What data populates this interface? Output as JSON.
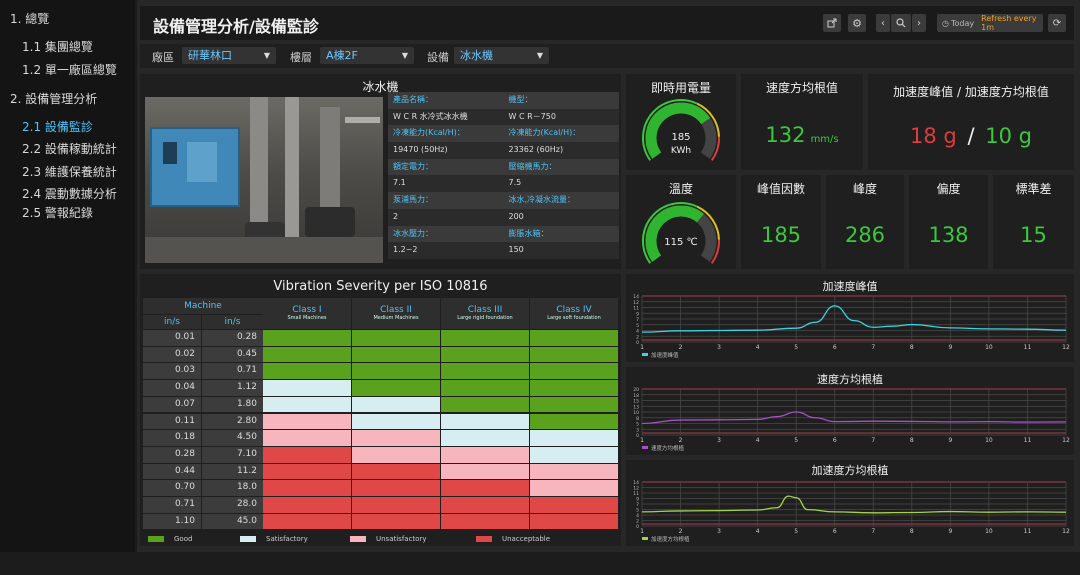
{
  "sidebar": {
    "items": [
      {
        "label": "1. 總覽"
      },
      {
        "label": "1.1 集團總覽"
      },
      {
        "label": "1.2 單一廠區總覽"
      },
      {
        "label": "2. 設備管理分析"
      },
      {
        "label": "2.1 設備監診"
      },
      {
        "label": "2.2 設備稼動統計"
      },
      {
        "label": "2.3 維護保養統計"
      },
      {
        "label": "2.4 震動數據分析"
      },
      {
        "label": "2.5 警報紀錄"
      }
    ]
  },
  "header": {
    "title": "設備管理分析/設備監診",
    "today_label": "Today",
    "refresh_label": "Refresh every 1m"
  },
  "filters": {
    "plant_label": "廠區",
    "plant_value": "研華林口",
    "floor_label": "樓層",
    "floor_value": "A棟2F",
    "device_label": "設備",
    "device_value": "冰水機"
  },
  "equipment": {
    "title": "冰水機",
    "rows": [
      [
        "產品名稱：",
        "機型："
      ],
      [
        "W C R 水冷式冰水機",
        "W C R－750"
      ],
      [
        "冷凍能力(Kcal/H)：",
        "冷凍能力(Kcal/H)："
      ],
      [
        "19470 (50Hz)",
        "23362 (60Hz)"
      ],
      [
        "額定電力：",
        "壓縮機馬力："
      ],
      [
        "7.1",
        "7.5"
      ],
      [
        "泵浦馬力：",
        "冰水,冷凝水流量："
      ],
      [
        "2",
        "200"
      ],
      [
        "冰水壓力：",
        "膨脹水箱："
      ],
      [
        "1.2~2",
        "150"
      ]
    ]
  },
  "power": {
    "title": "即時用電量",
    "value": "185",
    "unit": "KWh",
    "level": 0.72
  },
  "temperature": {
    "title": "溫度",
    "value": "115 ℃",
    "level": 0.66
  },
  "velocity_rms": {
    "title": "速度方均根值",
    "value": "132",
    "unit": "mm/s"
  },
  "accel": {
    "title": "加速度峰值 / 加速度方均根值",
    "peak": "18 g",
    "sep": "/",
    "rms": "10 g"
  },
  "stats": [
    {
      "title": "峰值因數",
      "value": "185"
    },
    {
      "title": "峰度",
      "value": "286"
    },
    {
      "title": "偏度",
      "value": "138"
    },
    {
      "title": "標準差",
      "value": "15"
    }
  ],
  "iso": {
    "title": "Vibration Severity per ISO 10816",
    "machine_label": "Machine",
    "unit_a": "in/s",
    "unit_b": "in/s",
    "classes": [
      {
        "name": "Class I",
        "sub": "Small Machines"
      },
      {
        "name": "Class II",
        "sub": "Medium Machines"
      },
      {
        "name": "Class III",
        "sub": "Large rigid foundation"
      },
      {
        "name": "Class IV",
        "sub": "Large soft foundation"
      }
    ],
    "rows": [
      {
        "a": "0.01",
        "b": "0.28",
        "grade": [
          "G",
          "G",
          "G",
          "G"
        ]
      },
      {
        "a": "0.02",
        "b": "0.45",
        "grade": [
          "G",
          "G",
          "G",
          "G"
        ]
      },
      {
        "a": "0.03",
        "b": "0.71",
        "grade": [
          "G",
          "G",
          "G",
          "G"
        ]
      },
      {
        "a": "0.04",
        "b": "1.12",
        "grade": [
          "S",
          "G",
          "G",
          "G"
        ]
      },
      {
        "a": "0.07",
        "b": "1.80",
        "grade": [
          "S",
          "S",
          "G",
          "G"
        ]
      },
      {
        "a": "0.11",
        "b": "2.80",
        "grade": [
          "U",
          "S",
          "S",
          "G"
        ]
      },
      {
        "a": "0.18",
        "b": "4.50",
        "grade": [
          "U",
          "U",
          "S",
          "S"
        ]
      },
      {
        "a": "0.28",
        "b": "7.10",
        "grade": [
          "A",
          "U",
          "U",
          "S"
        ]
      },
      {
        "a": "0.44",
        "b": "11.2",
        "grade": [
          "A",
          "A",
          "U",
          "U"
        ]
      },
      {
        "a": "0.70",
        "b": "18.0",
        "grade": [
          "A",
          "A",
          "A",
          "U"
        ]
      },
      {
        "a": "0.71",
        "b": "28.0",
        "grade": [
          "A",
          "A",
          "A",
          "A"
        ]
      },
      {
        "a": "1.10",
        "b": "45.0",
        "grade": [
          "A",
          "A",
          "A",
          "A"
        ]
      }
    ],
    "legend": [
      {
        "key": "G",
        "label": "Good",
        "color": "#5aa21e"
      },
      {
        "key": "S",
        "label": "Satisfactory",
        "color": "#d6eef2"
      },
      {
        "key": "U",
        "label": "Unsatisfactory",
        "color": "#f7b6bd"
      },
      {
        "key": "A",
        "label": "Unacceptable",
        "color": "#e04848"
      }
    ]
  },
  "chart_data": [
    {
      "type": "line",
      "title": "加速度峰值",
      "series_name": "加速度峰值",
      "color": "#3fd2e0",
      "xlim": [
        1,
        12
      ],
      "ylim": [
        0,
        14
      ],
      "ticks": [
        "1",
        "2",
        "3",
        "4",
        "5",
        "6",
        "7",
        "8",
        "9",
        "10",
        "11",
        "12"
      ],
      "x": [
        1,
        2,
        3,
        4,
        5,
        5.5,
        6,
        6.5,
        7,
        7.5,
        8,
        9,
        10,
        11,
        12
      ],
      "y": [
        3,
        3.4,
        3.5,
        3.6,
        4.2,
        6,
        11,
        6.5,
        4.5,
        4.8,
        5.3,
        4.3,
        4,
        3.9,
        3.6
      ]
    },
    {
      "type": "line",
      "title": "速度方均根植",
      "series_name": "速度方均根植",
      "color": "#a94fc8",
      "xlim": [
        1,
        12
      ],
      "ylim": [
        0,
        20
      ],
      "ticks": [
        "1",
        "2",
        "3",
        "4",
        "5",
        "6",
        "7",
        "8",
        "9",
        "10",
        "11",
        "12"
      ],
      "x": [
        1,
        2,
        3,
        4,
        4.5,
        5,
        5.5,
        6,
        7,
        8,
        9,
        10,
        11,
        12
      ],
      "y": [
        5,
        6.5,
        6.6,
        6.8,
        8,
        10,
        7.5,
        5.8,
        6,
        5.9,
        5.7,
        5.8,
        5.6,
        5.7
      ]
    },
    {
      "type": "line",
      "title": "加速度方均根植",
      "series_name": "加速度方均根植",
      "color": "#a6d24a",
      "xlim": [
        1,
        12
      ],
      "ylim": [
        0,
        14
      ],
      "ticks": [
        "1",
        "2",
        "3",
        "4",
        "5",
        "6",
        "7",
        "8",
        "9",
        "10",
        "11",
        "12"
      ],
      "x": [
        1,
        2,
        3,
        4,
        4.5,
        4.8,
        5,
        5.3,
        6,
        7,
        8,
        9,
        10,
        11,
        12
      ],
      "y": [
        4.5,
        4.8,
        4.9,
        5.1,
        5.8,
        9.5,
        9,
        5.2,
        4.5,
        4.2,
        4.3,
        4.6,
        4.4,
        4.5,
        4.4
      ]
    }
  ]
}
